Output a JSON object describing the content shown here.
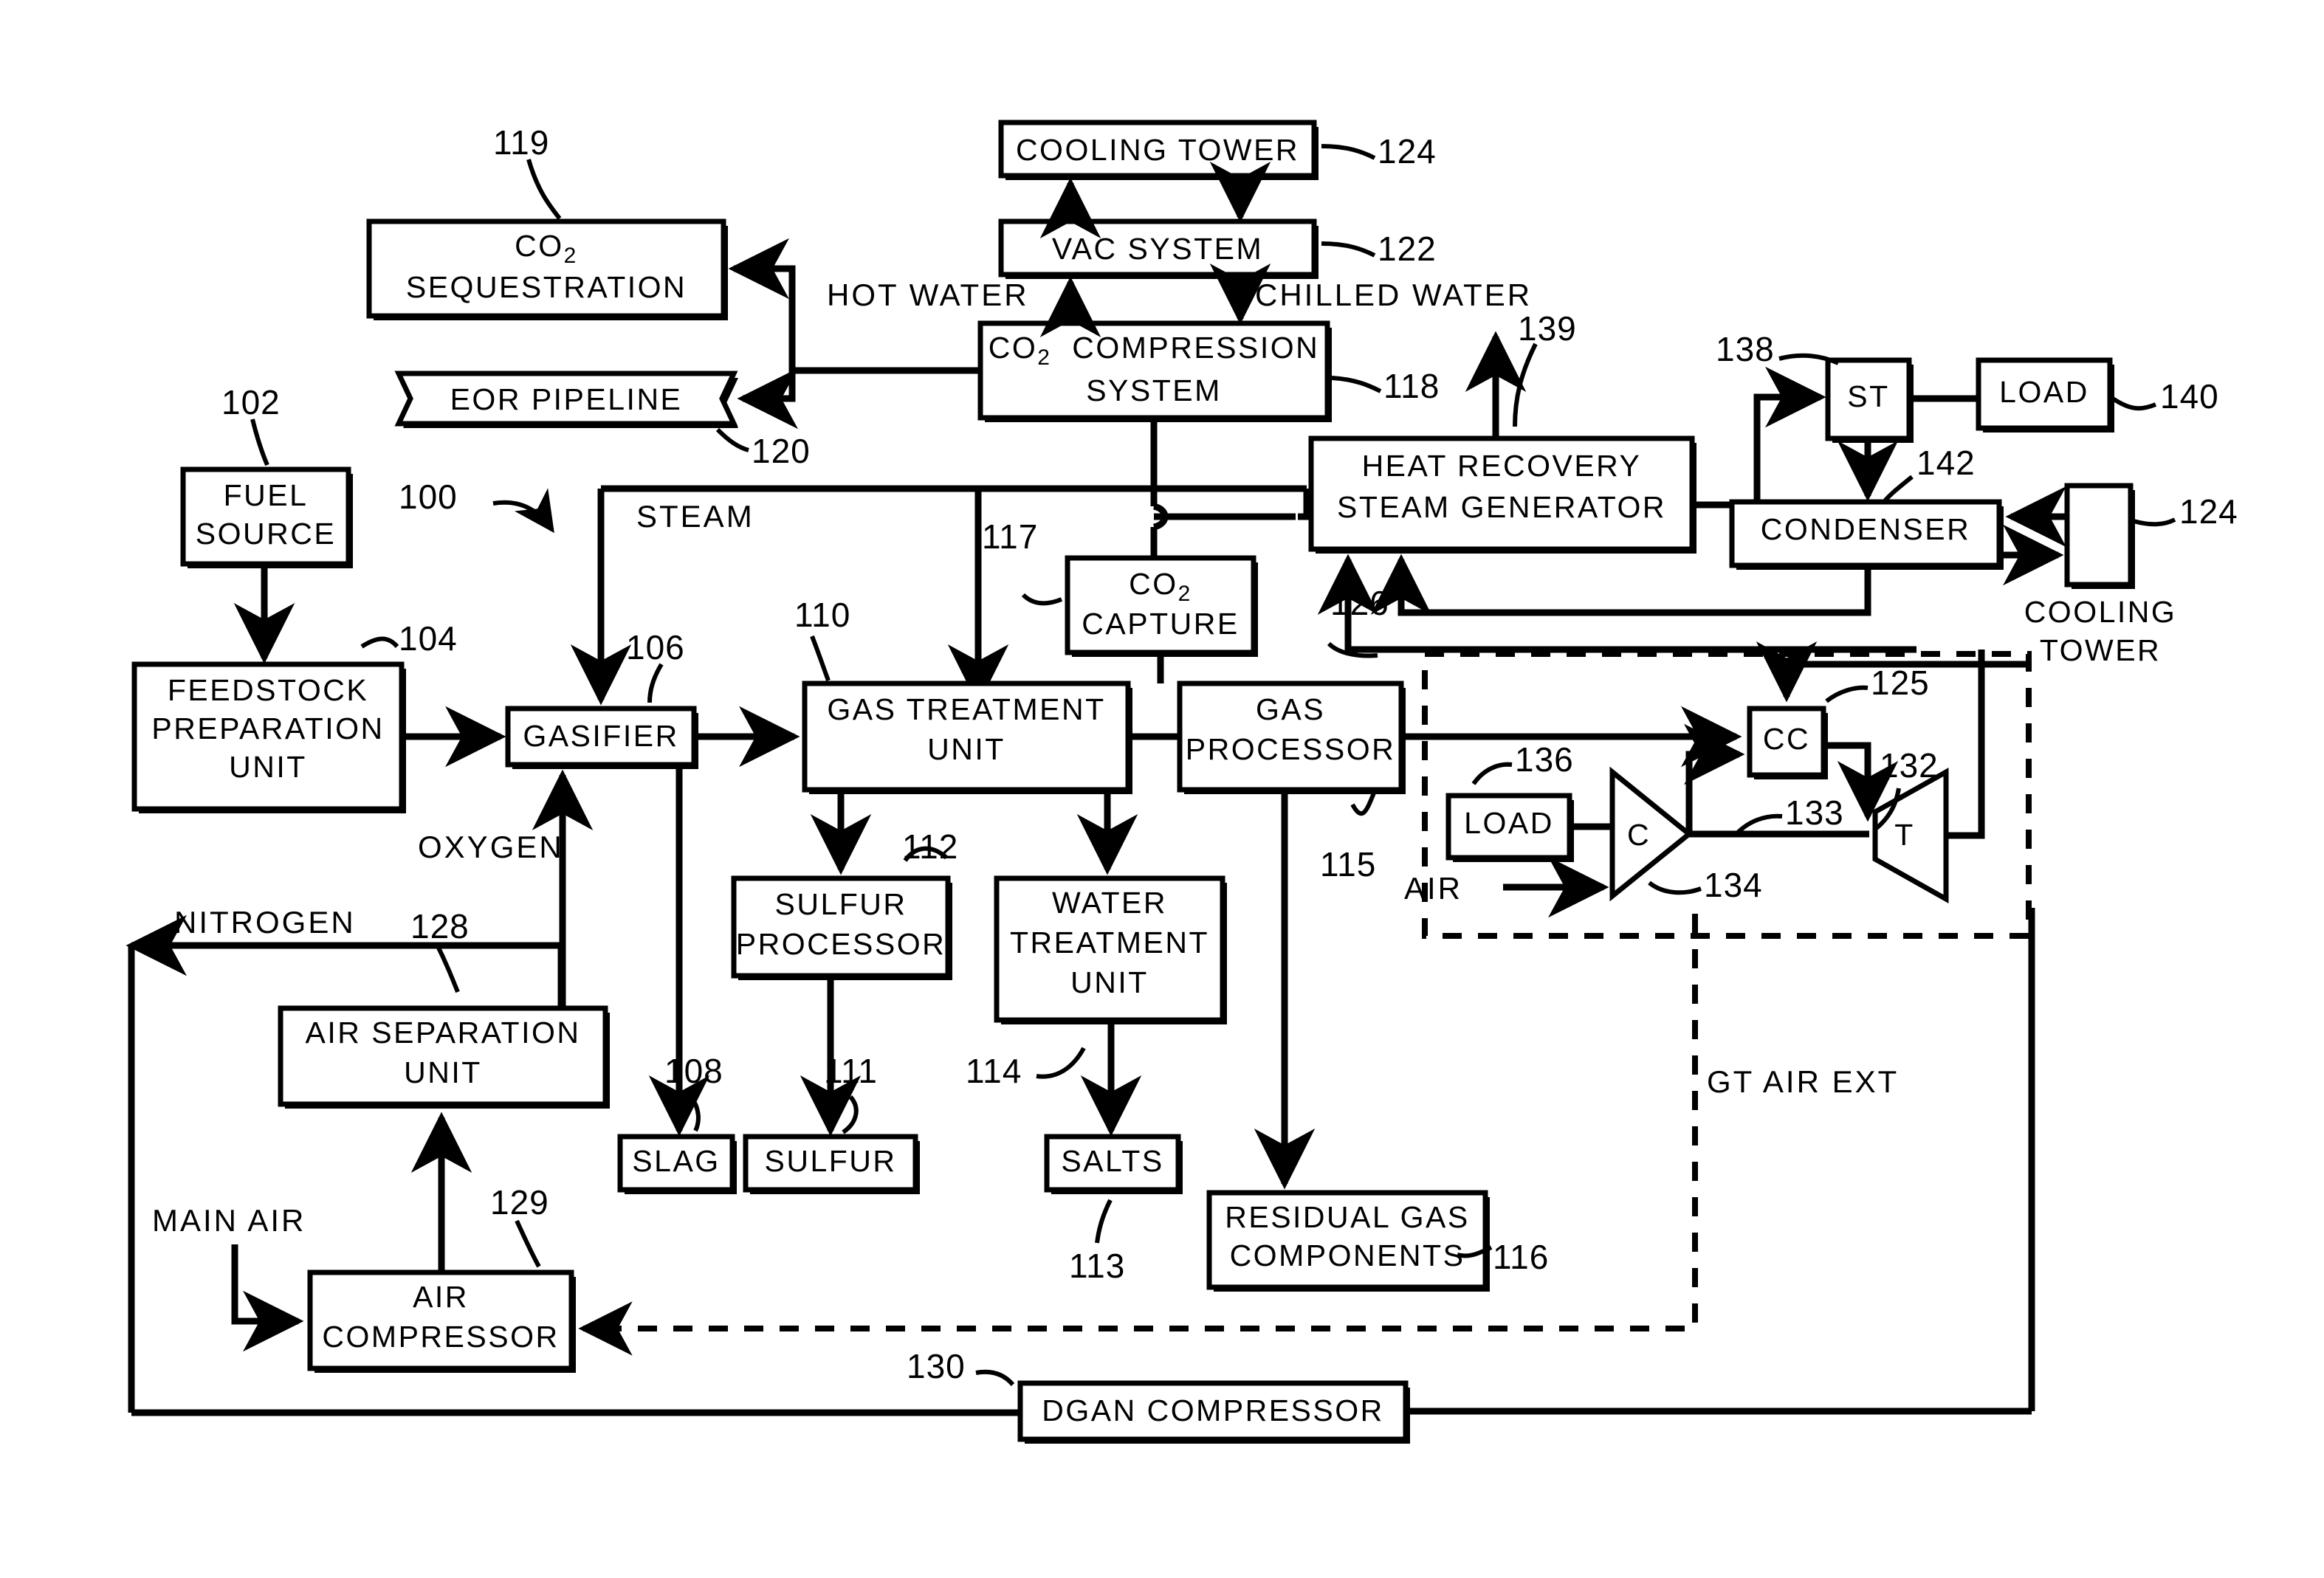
{
  "diagram": {
    "figure_ref": "100",
    "boxes": {
      "fuel_source": "FUEL\nSOURCE",
      "fuel_source_l1": "FUEL",
      "fuel_source_l2": "SOURCE",
      "feedstock_l1": "FEEDSTOCK",
      "feedstock_l2": "PREPARATION",
      "feedstock_l3": "UNIT",
      "gasifier": "GASIFIER",
      "gas_treatment_l1": "GAS  TREATMENT",
      "gas_treatment_l2": "UNIT",
      "gas_processor_l1": "GAS",
      "gas_processor_l2": "PROCESSOR",
      "co2_capture_l1": "CO",
      "co2_capture_sub": "2",
      "co2_capture_l2": "CAPTURE",
      "co2_sequestration_l1": "CO",
      "co2_sequestration_sub": "2",
      "co2_sequestration_l2": "SEQUESTRATION",
      "eor_pipeline": "EOR  PIPELINE",
      "co2_compression_l1": "CO",
      "co2_compression_sub": "2",
      "co2_compression_l1b": "COMPRESSION",
      "co2_compression_l2": "SYSTEM",
      "vac_system": "VAC  SYSTEM",
      "cooling_tower_top": "COOLING  TOWER",
      "hrsg_l1": "HEAT  RECOVERY",
      "hrsg_l2": "STEAM  GENERATOR",
      "st": "ST",
      "load_right": "LOAD",
      "condenser": "CONDENSER",
      "cooling_tower_right_l1": "COOLING",
      "cooling_tower_right_l2": "TOWER",
      "cc": "CC",
      "compressor_c": "C",
      "turbine_t": "T",
      "load_gt": "LOAD",
      "sulfur_processor_l1": "SULFUR",
      "sulfur_processor_l2": "PROCESSOR",
      "water_treatment_l1": "WATER",
      "water_treatment_l2": "TREATMENT",
      "water_treatment_l3": "UNIT",
      "slag": "SLAG",
      "sulfur": "SULFUR",
      "salts": "SALTS",
      "residual_l1": "RESIDUAL  GAS",
      "residual_l2": "COMPONENTS",
      "air_separation_l1": "AIR  SEPARATION",
      "air_separation_l2": "UNIT",
      "air_compressor_l1": "AIR",
      "air_compressor_l2": "COMPRESSOR",
      "dgan_compressor": "DGAN  COMPRESSOR"
    },
    "stream_labels": {
      "hot_water": "HOT  WATER",
      "chilled_water": "CHILLED  WATER",
      "steam": "STEAM",
      "oxygen": "OXYGEN",
      "nitrogen": "NITROGEN",
      "main_air": "MAIN  AIR",
      "air": "AIR",
      "gt_air_ext": "GT  AIR  EXT"
    },
    "reference_numerals": {
      "n100": "100",
      "n102": "102",
      "n104": "104",
      "n106": "106",
      "n108": "108",
      "n110": "110",
      "n111": "111",
      "n112": "112",
      "n113": "113",
      "n114": "114",
      "n115": "115",
      "n116": "116",
      "n117": "117",
      "n118": "118",
      "n119": "119",
      "n120": "120",
      "n122": "122",
      "n124a": "124",
      "n124b": "124",
      "n125": "125",
      "n126": "126",
      "n128": "128",
      "n129": "129",
      "n130": "130",
      "n132": "132",
      "n133": "133",
      "n134": "134",
      "n136": "136",
      "n138": "138",
      "n139": "139",
      "n140": "140",
      "n142": "142"
    },
    "colors": {
      "ink": "#000000",
      "paper": "#ffffff"
    }
  }
}
